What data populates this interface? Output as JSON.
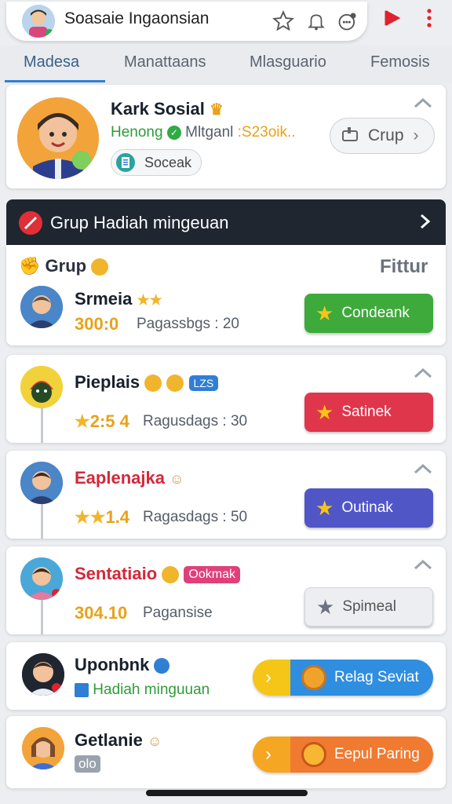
{
  "app": {
    "title": "Soasaie Ingaonsian"
  },
  "tabs": [
    {
      "label": "Madesa"
    },
    {
      "label": "Manattaans"
    },
    {
      "label": "Mlasguario"
    },
    {
      "label": "Femosis"
    }
  ],
  "profile": {
    "name": "Kark Sosial",
    "status": "Henong",
    "meta": "Mltganl",
    "points": ":S23oik..",
    "badge_label": "Soceak",
    "group_button": "Crup"
  },
  "banner": {
    "title": "Grup Hadiah mingeuan"
  },
  "group_header": {
    "left_label": "Grup",
    "right_label": "Fittur"
  },
  "members": [
    {
      "name": "Srmeia",
      "score": "300:0",
      "detail": "Pagassbgs : 20",
      "action": "Condeank",
      "color": "#3daa3b"
    },
    {
      "name": "Pieplais",
      "tag": "LZS",
      "score": "2:5 4",
      "detail": "Ragusdags : 30",
      "action": "Satinek",
      "color": "#e0364c"
    },
    {
      "name": "Eaplenajka",
      "score": "1.4",
      "detail": "Ragasdags : 50",
      "action": "Outinak",
      "color": "#5156c7"
    },
    {
      "name": "Sentatiaio",
      "tag": "Ookmak",
      "score": "304.10",
      "detail": "Pagansise",
      "action": "Spimeal",
      "color": "#eceef1"
    }
  ],
  "rewards": [
    {
      "name": "Uponbnk",
      "detail": "Hadiah minguuan",
      "action": "Relag Seviat"
    },
    {
      "name": "Getlanie",
      "detail": "olo",
      "action": "Eepul Paring"
    }
  ],
  "icons": {
    "accent": "#2f7fd4",
    "play": "#e0222d",
    "menu": "#e0222d"
  }
}
